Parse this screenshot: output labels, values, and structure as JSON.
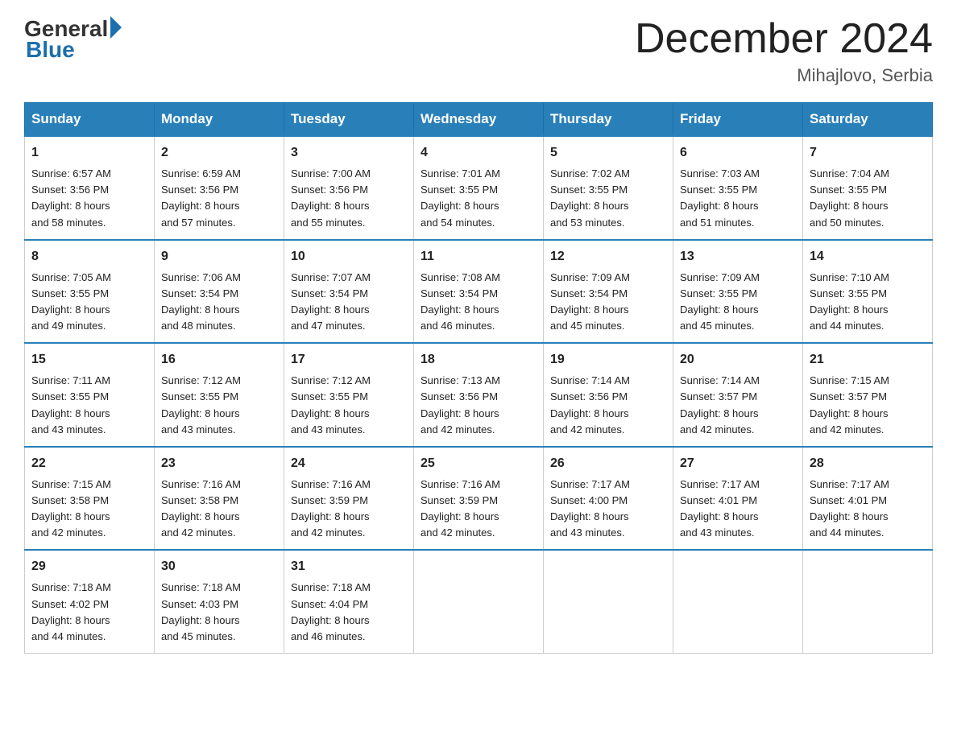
{
  "header": {
    "logo_general": "General",
    "logo_blue": "Blue",
    "month_title": "December 2024",
    "location": "Mihajlovo, Serbia"
  },
  "days_of_week": [
    "Sunday",
    "Monday",
    "Tuesday",
    "Wednesday",
    "Thursday",
    "Friday",
    "Saturday"
  ],
  "weeks": [
    [
      {
        "day": "1",
        "sunrise": "6:57 AM",
        "sunset": "3:56 PM",
        "daylight": "8 hours and 58 minutes."
      },
      {
        "day": "2",
        "sunrise": "6:59 AM",
        "sunset": "3:56 PM",
        "daylight": "8 hours and 57 minutes."
      },
      {
        "day": "3",
        "sunrise": "7:00 AM",
        "sunset": "3:56 PM",
        "daylight": "8 hours and 55 minutes."
      },
      {
        "day": "4",
        "sunrise": "7:01 AM",
        "sunset": "3:55 PM",
        "daylight": "8 hours and 54 minutes."
      },
      {
        "day": "5",
        "sunrise": "7:02 AM",
        "sunset": "3:55 PM",
        "daylight": "8 hours and 53 minutes."
      },
      {
        "day": "6",
        "sunrise": "7:03 AM",
        "sunset": "3:55 PM",
        "daylight": "8 hours and 51 minutes."
      },
      {
        "day": "7",
        "sunrise": "7:04 AM",
        "sunset": "3:55 PM",
        "daylight": "8 hours and 50 minutes."
      }
    ],
    [
      {
        "day": "8",
        "sunrise": "7:05 AM",
        "sunset": "3:55 PM",
        "daylight": "8 hours and 49 minutes."
      },
      {
        "day": "9",
        "sunrise": "7:06 AM",
        "sunset": "3:54 PM",
        "daylight": "8 hours and 48 minutes."
      },
      {
        "day": "10",
        "sunrise": "7:07 AM",
        "sunset": "3:54 PM",
        "daylight": "8 hours and 47 minutes."
      },
      {
        "day": "11",
        "sunrise": "7:08 AM",
        "sunset": "3:54 PM",
        "daylight": "8 hours and 46 minutes."
      },
      {
        "day": "12",
        "sunrise": "7:09 AM",
        "sunset": "3:54 PM",
        "daylight": "8 hours and 45 minutes."
      },
      {
        "day": "13",
        "sunrise": "7:09 AM",
        "sunset": "3:55 PM",
        "daylight": "8 hours and 45 minutes."
      },
      {
        "day": "14",
        "sunrise": "7:10 AM",
        "sunset": "3:55 PM",
        "daylight": "8 hours and 44 minutes."
      }
    ],
    [
      {
        "day": "15",
        "sunrise": "7:11 AM",
        "sunset": "3:55 PM",
        "daylight": "8 hours and 43 minutes."
      },
      {
        "day": "16",
        "sunrise": "7:12 AM",
        "sunset": "3:55 PM",
        "daylight": "8 hours and 43 minutes."
      },
      {
        "day": "17",
        "sunrise": "7:12 AM",
        "sunset": "3:55 PM",
        "daylight": "8 hours and 43 minutes."
      },
      {
        "day": "18",
        "sunrise": "7:13 AM",
        "sunset": "3:56 PM",
        "daylight": "8 hours and 42 minutes."
      },
      {
        "day": "19",
        "sunrise": "7:14 AM",
        "sunset": "3:56 PM",
        "daylight": "8 hours and 42 minutes."
      },
      {
        "day": "20",
        "sunrise": "7:14 AM",
        "sunset": "3:57 PM",
        "daylight": "8 hours and 42 minutes."
      },
      {
        "day": "21",
        "sunrise": "7:15 AM",
        "sunset": "3:57 PM",
        "daylight": "8 hours and 42 minutes."
      }
    ],
    [
      {
        "day": "22",
        "sunrise": "7:15 AM",
        "sunset": "3:58 PM",
        "daylight": "8 hours and 42 minutes."
      },
      {
        "day": "23",
        "sunrise": "7:16 AM",
        "sunset": "3:58 PM",
        "daylight": "8 hours and 42 minutes."
      },
      {
        "day": "24",
        "sunrise": "7:16 AM",
        "sunset": "3:59 PM",
        "daylight": "8 hours and 42 minutes."
      },
      {
        "day": "25",
        "sunrise": "7:16 AM",
        "sunset": "3:59 PM",
        "daylight": "8 hours and 42 minutes."
      },
      {
        "day": "26",
        "sunrise": "7:17 AM",
        "sunset": "4:00 PM",
        "daylight": "8 hours and 43 minutes."
      },
      {
        "day": "27",
        "sunrise": "7:17 AM",
        "sunset": "4:01 PM",
        "daylight": "8 hours and 43 minutes."
      },
      {
        "day": "28",
        "sunrise": "7:17 AM",
        "sunset": "4:01 PM",
        "daylight": "8 hours and 44 minutes."
      }
    ],
    [
      {
        "day": "29",
        "sunrise": "7:18 AM",
        "sunset": "4:02 PM",
        "daylight": "8 hours and 44 minutes."
      },
      {
        "day": "30",
        "sunrise": "7:18 AM",
        "sunset": "4:03 PM",
        "daylight": "8 hours and 45 minutes."
      },
      {
        "day": "31",
        "sunrise": "7:18 AM",
        "sunset": "4:04 PM",
        "daylight": "8 hours and 46 minutes."
      },
      null,
      null,
      null,
      null
    ]
  ],
  "labels": {
    "sunrise": "Sunrise:",
    "sunset": "Sunset:",
    "daylight": "Daylight:"
  }
}
